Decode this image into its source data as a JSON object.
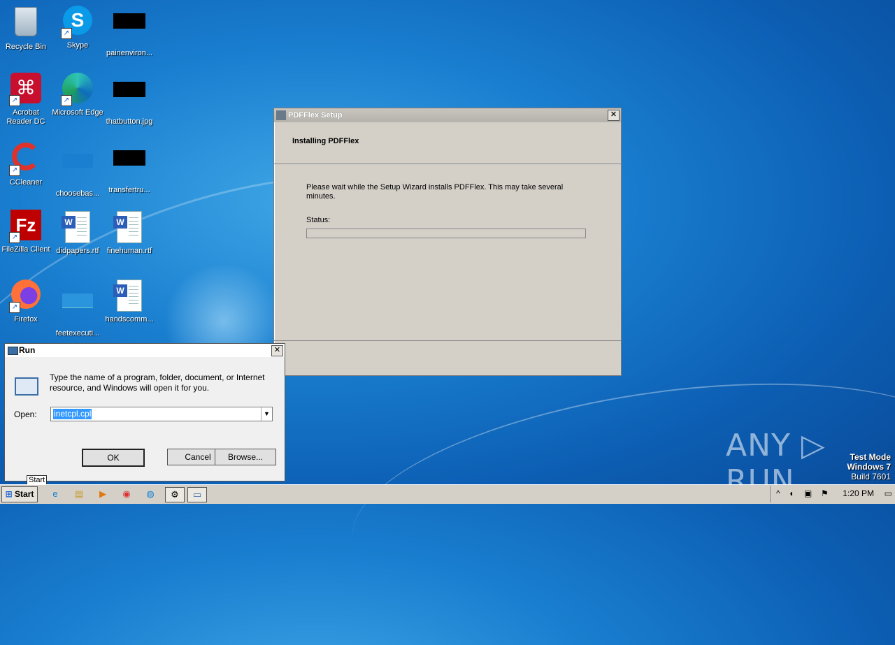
{
  "desktop_icons": [
    {
      "label": "Recycle Bin"
    },
    {
      "label": "Skype"
    },
    {
      "label": "painenviron..."
    },
    {
      "label": "Acrobat Reader DC"
    },
    {
      "label": "Microsoft Edge"
    },
    {
      "label": "thatbutton.jpg"
    },
    {
      "label": "CCleaner"
    },
    {
      "label": "choosebas..."
    },
    {
      "label": "transfertru..."
    },
    {
      "label": "FileZilla Client"
    },
    {
      "label": "didpapers.rtf"
    },
    {
      "label": "finehuman.rtf"
    },
    {
      "label": "Firefox"
    },
    {
      "label": "feetexecuti..."
    },
    {
      "label": "handscomm..."
    }
  ],
  "setup_window": {
    "title": "PDFFlex Setup",
    "heading": "Installing PDFFlex",
    "message": "Please wait while the Setup Wizard installs PDFFlex.  This may take several minutes.",
    "status_label": "Status:",
    "progress": 0.0,
    "close": "✕"
  },
  "run_dialog": {
    "title": "Run",
    "description": "Type the name of a program, folder, document, or Internet resource, and Windows will open it for you.",
    "open_label": "Open:",
    "open_value": "inetcpl.cpl",
    "ok": "OK",
    "cancel": "Cancel",
    "browse": "Browse...",
    "close": "✕"
  },
  "tooltip": "Start",
  "watermark": "ANY ▷ RUN",
  "test_mode": {
    "line1": "Test Mode",
    "line2": "Windows 7",
    "line3": "Build 7601"
  },
  "taskbar": {
    "start_label": "Start",
    "clock": "1:20 PM"
  }
}
